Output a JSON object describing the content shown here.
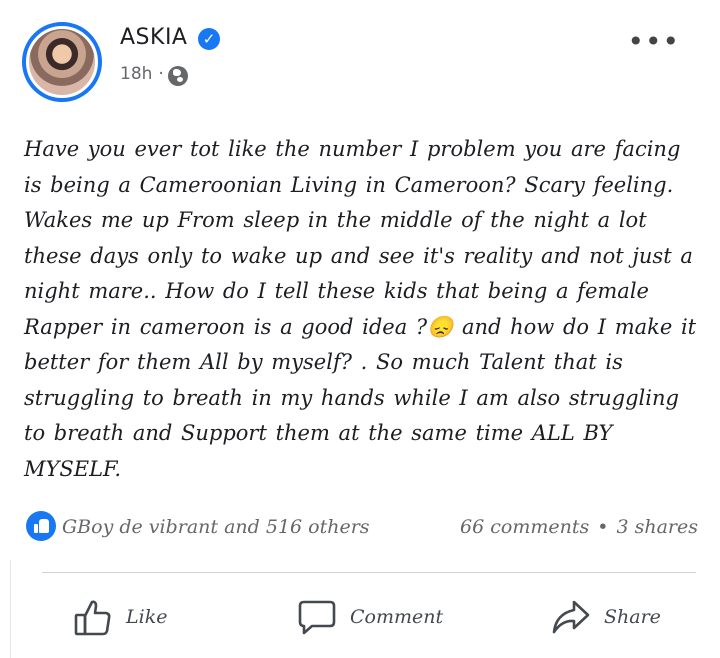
{
  "post": {
    "author": "ASKIA",
    "time": "18h",
    "separator": "·",
    "more": "•••",
    "text": "Have you ever tot like the number I problem you are facing is being a Cameroonian Living in Cameroon? Scary feeling. Wakes me up From sleep in the middle of the night a lot these days only to wake up and see it's reality and not  just a night mare.. How do I tell these kids that being a female Rapper in cameroon is a good idea ?😞 and how do I make it better for them All by myself? . So much Talent that is struggling to breath in my hands while I am also struggling to breath  and Support them at the same time ALL BY MYSELF."
  },
  "stats": {
    "reactors": "GBoy de vibrant and 516 others",
    "comments": "66 comments",
    "dot": "•",
    "shares": "3 shares"
  },
  "actions": {
    "like": "Like",
    "comment": "Comment",
    "share": "Share"
  },
  "icons": {
    "verified": "verified-badge-icon",
    "privacy": "globe-icon",
    "like": "thumbs-up-icon",
    "comment": "speech-bubble-icon",
    "share": "share-arrow-icon"
  },
  "colors": {
    "accent": "#1877f2",
    "muted": "#65676b"
  }
}
